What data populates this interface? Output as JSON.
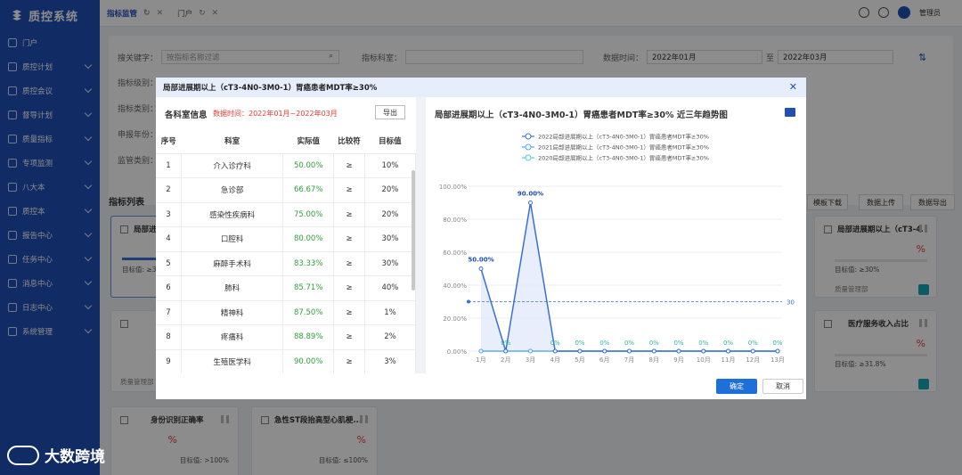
{
  "app": {
    "title": "质控系统"
  },
  "sidebar": {
    "items": [
      {
        "label": "门户",
        "expand": false
      },
      {
        "label": "质控计划",
        "expand": true
      },
      {
        "label": "质控会议",
        "expand": true
      },
      {
        "label": "督导计划",
        "expand": true
      },
      {
        "label": "质量指标",
        "expand": true
      },
      {
        "label": "专项监测",
        "expand": true
      },
      {
        "label": "八大本",
        "expand": true
      },
      {
        "label": "质控本",
        "expand": true
      },
      {
        "label": "报告中心",
        "expand": true
      },
      {
        "label": "任务中心",
        "expand": true
      },
      {
        "label": "消息中心",
        "expand": true
      },
      {
        "label": "日志中心",
        "expand": true
      },
      {
        "label": "系统管理",
        "expand": true
      }
    ]
  },
  "tabs": [
    {
      "label": "指标监管",
      "active": true
    },
    {
      "label": "门户",
      "active": false
    }
  ],
  "user": {
    "name": "管理员"
  },
  "filter": {
    "keyword_label": "搜关键字：",
    "keyword_placeholder": "按指标名称过滤",
    "dept_label": "指标科室：",
    "time_label": "数据时间：",
    "start": "2022年01月",
    "sep": "至",
    "end": "2022年03月",
    "labels": [
      "指标级别：",
      "指标类别：",
      "申报年份：",
      "监管类别："
    ]
  },
  "list": {
    "title": "指标列表",
    "buttons": [
      "模板下载",
      "数据上传",
      "数据导出"
    ]
  },
  "cards": [
    {
      "title": "局部进展期以上（cT3-4...",
      "pct": "%",
      "target": "目标值: ≥30%",
      "group": "质量管理部"
    },
    {
      "title": "医疗服务收入占比",
      "pct": "%",
      "target": "目标值: ≥31.8%",
      "group": ""
    },
    {
      "title": "身份识别正确率",
      "pct": "%",
      "target": "目标值: >100%",
      "group": ""
    },
    {
      "title": "急性ST段抬高型心肌梗...",
      "pct": "%",
      "target": "目标值: ≤100%",
      "group": ""
    }
  ],
  "bg_fragments": {
    "card1_title": "局部进展",
    "card1_target": "目标值: ≥30",
    "card3_group": "质量管理部"
  },
  "modal": {
    "title": "局部进展期以上（cT3-4N0-3M0-1）胃癌患者MDT率≥30%",
    "left_title": "各科室信息",
    "range": "数据时间：2022年01月~2022年03月",
    "export": "导出",
    "columns": [
      "序号",
      "科室",
      "实际值",
      "比较符",
      "目标值"
    ],
    "rows": [
      [
        "1",
        "介入诊疗科",
        "50.00%",
        "≥",
        "10%"
      ],
      [
        "2",
        "急诊部",
        "66.67%",
        "≥",
        "20%"
      ],
      [
        "3",
        "感染性疾病科",
        "75.00%",
        "≥",
        "20%"
      ],
      [
        "4",
        "口腔科",
        "80.00%",
        "≥",
        "30%"
      ],
      [
        "5",
        "麻醉手术科",
        "83.33%",
        "≥",
        "30%"
      ],
      [
        "6",
        "肺科",
        "85.71%",
        "≥",
        "40%"
      ],
      [
        "7",
        "精神科",
        "87.50%",
        "≥",
        "1%"
      ],
      [
        "8",
        "疼痛科",
        "88.89%",
        "≥",
        "2%"
      ],
      [
        "9",
        "生殖医学科",
        "90.00%",
        "≥",
        "3%"
      ]
    ],
    "chart_title": "局部进展期以上（cT3-4N0-3M0-1）胃癌患者MDT率≥30% 近三年趋势图",
    "ok": "确定",
    "cancel": "取消"
  },
  "chart_data": {
    "type": "line",
    "categories": [
      "1月",
      "2月",
      "3月",
      "4月",
      "5月",
      "6月",
      "7月",
      "8月",
      "9月",
      "10月",
      "11月",
      "12月",
      "13月"
    ],
    "ylim": [
      0,
      100
    ],
    "yticks": [
      "0.00%",
      "20.00%",
      "40.00%",
      "60.00%",
      "80.00%",
      "100.00%"
    ],
    "series": [
      {
        "name": "2022局部进展期以上（cT3-4N0-3M0-1）胃癌患者MDT率≥30%",
        "values": [
          50,
          0,
          90,
          0,
          0,
          0,
          0,
          0,
          0,
          0,
          0,
          0,
          0
        ],
        "labels": [
          "50.00%",
          "0%",
          "90.00%",
          "0%",
          "0%",
          "0%",
          "0%",
          "0%",
          "0%",
          "0%",
          "0%",
          "0%",
          "0%"
        ],
        "color": "#3b6fd8"
      },
      {
        "name": "2021局部进展期以上（cT3-4N0-3M0-1）胃癌患者MDT率≥30%",
        "values": [
          0,
          0,
          0,
          0,
          0,
          0,
          0,
          0,
          0,
          0,
          0,
          0,
          0
        ],
        "color": "#5ba3e8"
      },
      {
        "name": "2020局部进展期以上（cT3-4N0-3M0-1）胃癌患者MDT率≥30%",
        "values": [
          0,
          0,
          0,
          0,
          0,
          0,
          0,
          0,
          0,
          0,
          0,
          0,
          0
        ],
        "color": "#4ed0d0"
      }
    ],
    "target_line": {
      "value": 30,
      "label": "30"
    }
  },
  "watermark": {
    "text": "大数跨境"
  }
}
